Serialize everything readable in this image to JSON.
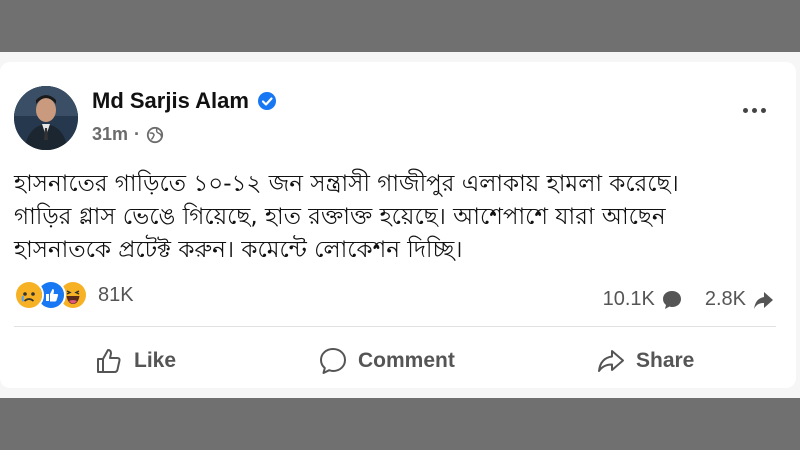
{
  "post": {
    "author": "Md Sarjis Alam",
    "time": "31m",
    "separator": "·",
    "lines": [
      "হাসনাতের গাড়িতে ১০-১২ জন সন্ত্রাসী গাজীপুর এলাকায় হামলা করেছে।",
      "গাড়ির গ্লাস ভেঙে গিয়েছে, হাত রক্তাক্ত হয়েছে। আশেপাশে যারা আছেন",
      "হাসনাতকে প্রটেক্ট করুন। কমেন্টে লোকেশন দিচ্ছি।"
    ]
  },
  "engagement": {
    "reactions_count": "81K",
    "comments_count": "10.1K",
    "shares_count": "2.8K",
    "reaction_icons": [
      "sad-reaction-icon",
      "like-reaction-icon",
      "haha-reaction-icon"
    ]
  },
  "actions": {
    "like_label": "Like",
    "comment_label": "Comment",
    "share_label": "Share"
  },
  "colors": {
    "like_blue": "#1877f2",
    "emoji_yellow": "#f7b125",
    "background_gray": "#707070"
  }
}
